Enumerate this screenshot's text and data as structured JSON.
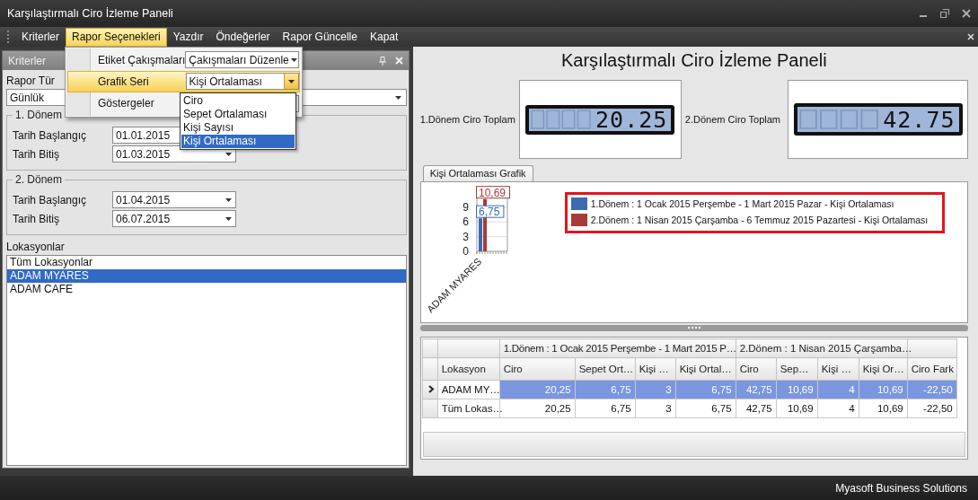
{
  "window": {
    "title": "Karşılaştırmalı Ciro İzleme Paneli"
  },
  "menu_bar": {
    "items": [
      {
        "label": "Kriterler",
        "selected": false
      },
      {
        "label": "Rapor Seçenekleri",
        "selected": true
      },
      {
        "label": "Yazdır",
        "selected": false
      },
      {
        "label": "Öndeğerler",
        "selected": false
      },
      {
        "label": "Rapor Güncelle",
        "selected": false
      },
      {
        "label": "Kapat",
        "selected": false
      }
    ]
  },
  "criteria_panel": {
    "title": "Kriterler",
    "report_type": {
      "label": "Rapor Tür",
      "value": "Günlük"
    },
    "periods": [
      {
        "title": "1. Dönem",
        "start": {
          "label": "Tarih Başlangıç",
          "value": "01.01.2015"
        },
        "end": {
          "label": "Tarih Bitiş",
          "value": "01.03.2015"
        }
      },
      {
        "title": "2. Dönem",
        "start": {
          "label": "Tarih Başlangıç",
          "value": "01.04.2015"
        },
        "end": {
          "label": "Tarih Bitiş",
          "value": "06.07.2015"
        }
      }
    ],
    "locations": {
      "label": "Lokasyonlar",
      "items": [
        {
          "label": "Tüm Lokasyonlar",
          "selected": false
        },
        {
          "label": "ADAM MYARES",
          "selected": true
        },
        {
          "label": "ADAM CAFE",
          "selected": false
        }
      ]
    }
  },
  "dashboard": {
    "title": "Karşılaştırmalı Ciro İzleme Paneli",
    "gauges": [
      {
        "label": "1.Dönem Ciro Toplam",
        "value": "20.25"
      },
      {
        "label": "2.Dönem Ciro Toplam",
        "value": "42.75"
      }
    ],
    "chart_tabs": [
      {
        "label": "Kişi Ortalaması Grafik",
        "selected": true
      }
    ],
    "chart_data": {
      "type": "bar",
      "categories": [
        "ADAM MYARES"
      ],
      "yticks": [
        0,
        3,
        6,
        9
      ],
      "ylim": [
        0,
        11
      ],
      "data_labels": true,
      "legend": true,
      "series": [
        {
          "name": "1.Dönem : 1 Ocak 2015 Perşembe - 1 Mart 2015 Pazar - Kişi Ortalaması",
          "color": "#3a6ab0",
          "values": [
            6.75
          ],
          "value_labels": [
            "6,75"
          ]
        },
        {
          "name": "2.Dönem : 1 Nisan 2015 Çarşamba - 6 Temmuz 2015 Pazartesi - Kişi Ortalaması",
          "color": "#a83a3a",
          "values": [
            10.69
          ],
          "value_labels": [
            "10,69"
          ]
        }
      ]
    }
  },
  "grid": {
    "column_groups": [
      {
        "columns": [
          "Lokasyon"
        ]
      },
      {
        "label": "1.Dönem : 1 Ocak 2015 Perşembe - 1 Mart 2015 P…",
        "columns": [
          "Ciro",
          "Sepet Ort…",
          "Kişi …",
          "Kişi Ortal…"
        ]
      },
      {
        "label": "2.Dönem : 1 Nisan 2015 Çarşamba…",
        "columns": [
          "Ciro",
          "Sep…",
          "Kişi …",
          "Kişi Or…"
        ]
      },
      {
        "columns": [
          "Ciro Fark"
        ]
      }
    ],
    "rows": [
      {
        "selected": true,
        "cells": [
          "ADAM MY…",
          "20,25",
          "6,75",
          "3",
          "6,75",
          "42,75",
          "10,69",
          "4",
          "10,69",
          "-22,50"
        ]
      },
      {
        "selected": false,
        "cells": [
          "Tüm Lokas…",
          "20,25",
          "6,75",
          "3",
          "6,75",
          "42,75",
          "10,69",
          "4",
          "10,69",
          "-22,50"
        ]
      }
    ]
  },
  "options_menu": {
    "items": [
      {
        "kind": "combo",
        "label": "Etiket Çakışmaları",
        "value": "Çakışmaları Düzenle",
        "selected": false
      },
      {
        "kind": "combo",
        "label": "Grafik Seri",
        "value": "Kişi Ortalaması",
        "selected": true
      },
      {
        "kind": "combo",
        "label": "Göstergeler",
        "selected": false
      }
    ]
  },
  "series_dropdown": {
    "options": [
      {
        "label": "Ciro",
        "selected": false
      },
      {
        "label": "Sepet Ortalaması",
        "selected": false
      },
      {
        "label": "Kişi Sayısı",
        "selected": false
      },
      {
        "label": "Kişi Ortalaması",
        "selected": true
      }
    ]
  },
  "status_bar": {
    "text": "Myasoft Business Solutions"
  }
}
